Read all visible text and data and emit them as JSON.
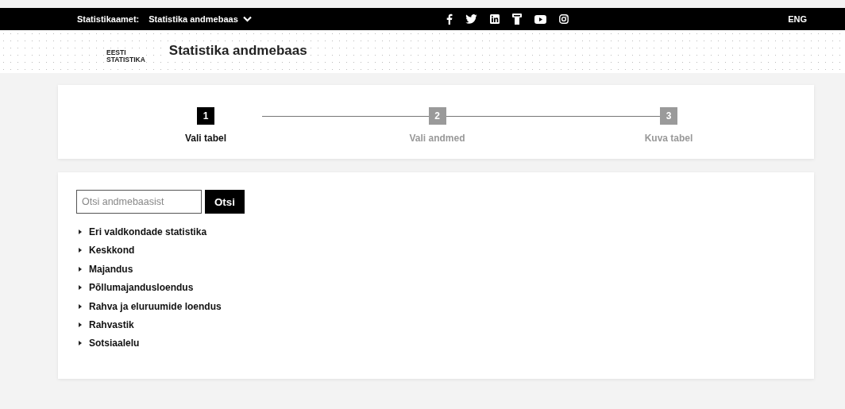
{
  "top_bar": {
    "label": "Statistikaamet:",
    "site_menu": "Statistika andmebaas",
    "language": "ENG"
  },
  "header": {
    "logo": [
      "EESTI",
      "STATISTIKA"
    ],
    "title": "Statistika andmebaas"
  },
  "steps": [
    {
      "number": "1",
      "label": "Vali tabel",
      "selected": true
    },
    {
      "number": "2",
      "label": "Vali andmed",
      "selected": false
    },
    {
      "number": "3",
      "label": "Kuva tabel",
      "selected": false
    }
  ],
  "search": {
    "placeholder": "Otsi andmebaasist",
    "button": "Otsi"
  },
  "tree": [
    {
      "label": "Eri valdkondade statistika",
      "expanded": false
    },
    {
      "label": "Keskkond",
      "expanded": false
    },
    {
      "label": "Majandus",
      "expanded": false
    },
    {
      "label": "Põllumajandusloendus",
      "expanded": false
    },
    {
      "label": "Rahva ja eluruumide loendus",
      "expanded": false
    },
    {
      "label": "Rahvastik",
      "expanded": false
    },
    {
      "label": "Sotsiaalelu",
      "expanded": false
    }
  ]
}
